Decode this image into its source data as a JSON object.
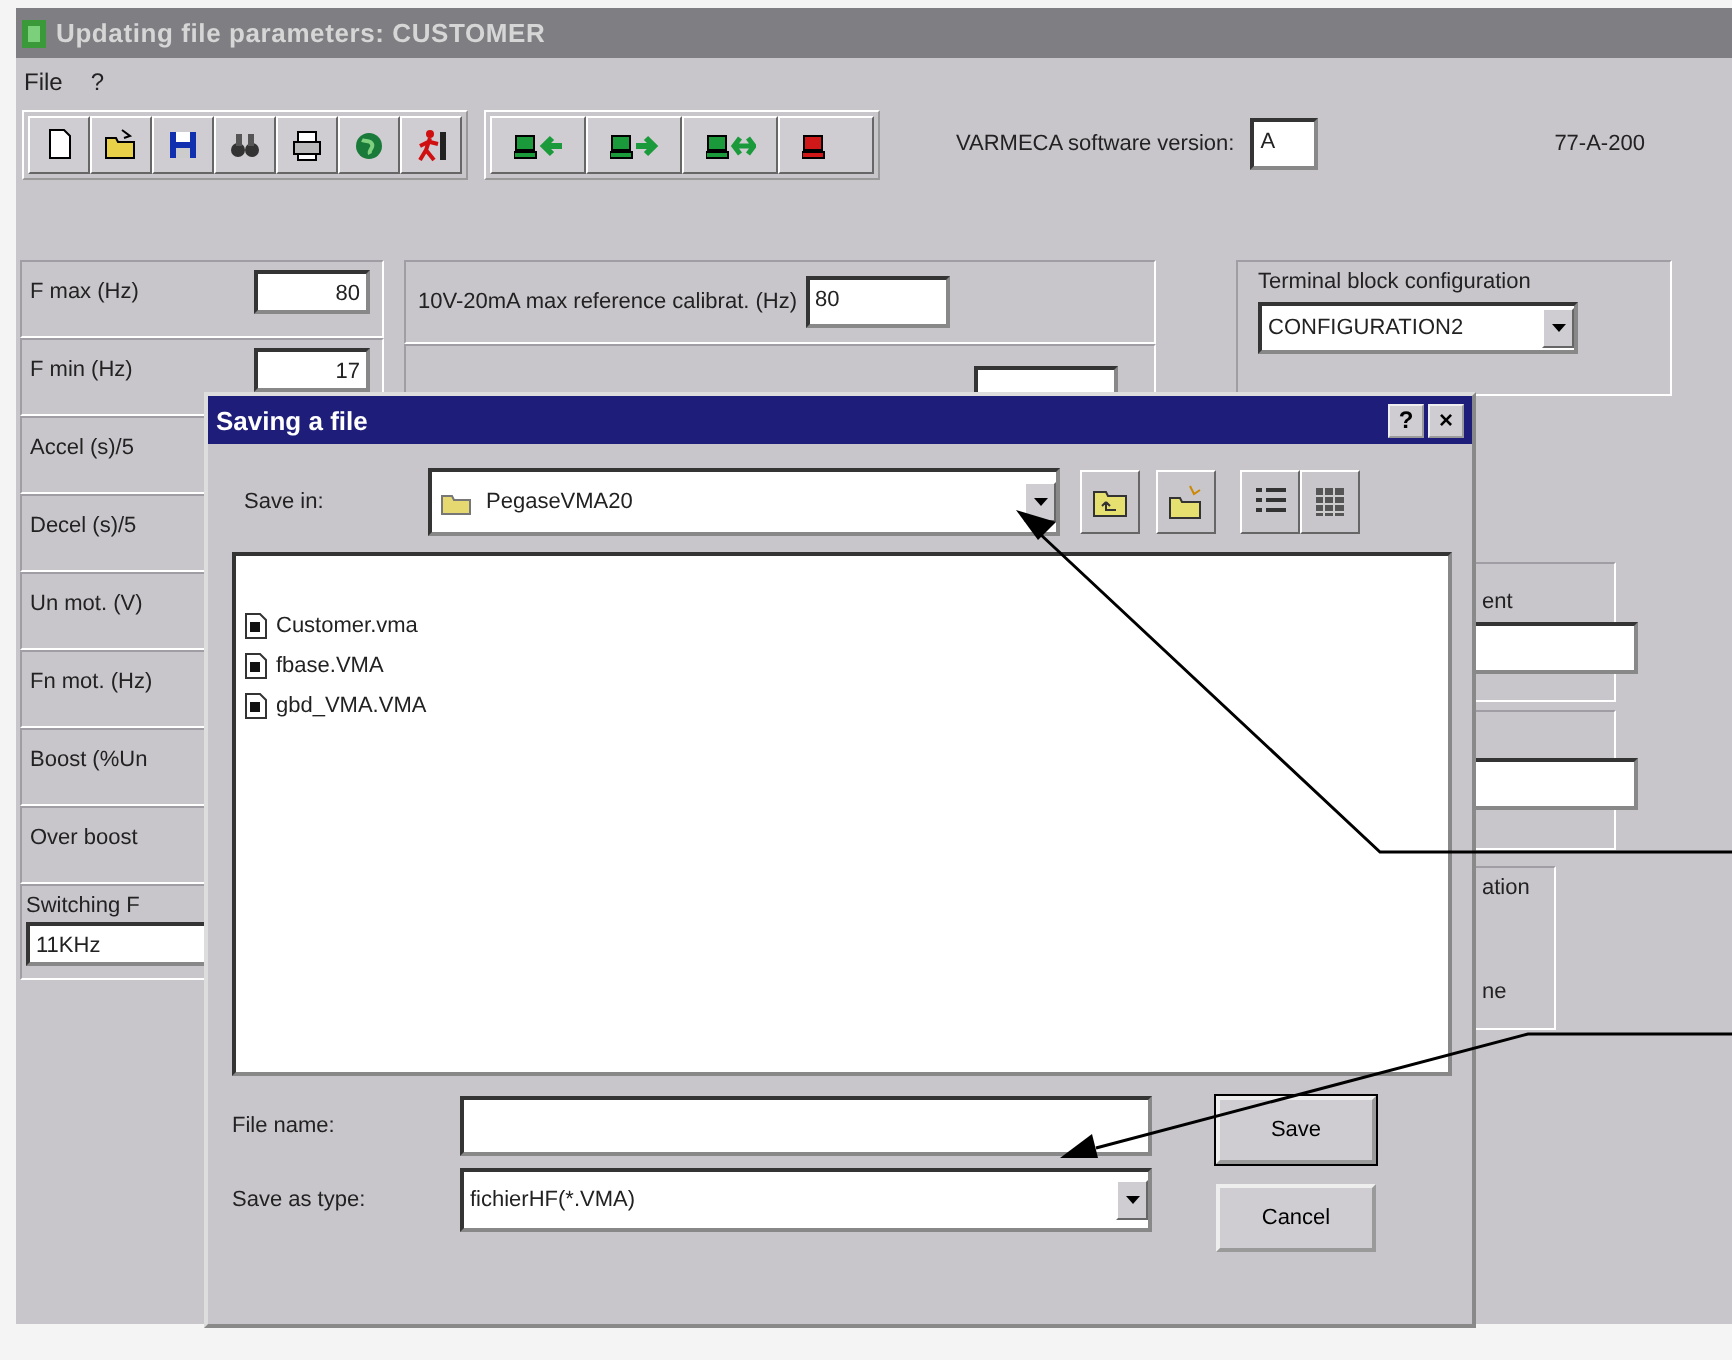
{
  "window": {
    "title": "Updating file parameters: CUSTOMER"
  },
  "menu": [
    "File",
    "?"
  ],
  "software_version": {
    "label": "VARMECA software version:",
    "value": "A"
  },
  "reference": "77-A-200",
  "parameters": [
    {
      "label": "F max (Hz)",
      "value": "80"
    },
    {
      "label": "F min (Hz)",
      "value": "17"
    },
    {
      "label": "Accel (s)/5"
    },
    {
      "label": "Decel (s)/5"
    },
    {
      "label": "Un mot. (V)"
    },
    {
      "label": "Fn mot. (Hz)"
    },
    {
      "label": "Boost (%Un"
    },
    {
      "label": "Over boost"
    }
  ],
  "switching": {
    "label": "Switching F",
    "value": "11KHz"
  },
  "calibration": {
    "label": "10V-20mA max reference calibrat. (Hz)",
    "value": "80"
  },
  "terminal_block": {
    "label": "Terminal block configuration",
    "value": "CONFIGURATION2"
  },
  "side_groups": [
    {
      "kind": "combo",
      "label": "ent"
    },
    {
      "kind": "combo"
    },
    {
      "kind": "option",
      "label": "ation",
      "option": "ne"
    }
  ],
  "dialog": {
    "title": "Saving a file",
    "help": "?",
    "close": "×",
    "save_in": {
      "label": "Save in:",
      "value": "PegaseVMA20"
    },
    "files": [
      "Customer.vma",
      "fbase.VMA",
      "gbd_VMA.VMA"
    ],
    "file_name": {
      "label": "File name:"
    },
    "save_as_type": {
      "label": "Save as type:",
      "value": "fichierHF(*.VMA)"
    },
    "buttons": [
      {
        "label": "Save",
        "default": true
      },
      {
        "label": "Cancel",
        "default": false
      }
    ]
  }
}
